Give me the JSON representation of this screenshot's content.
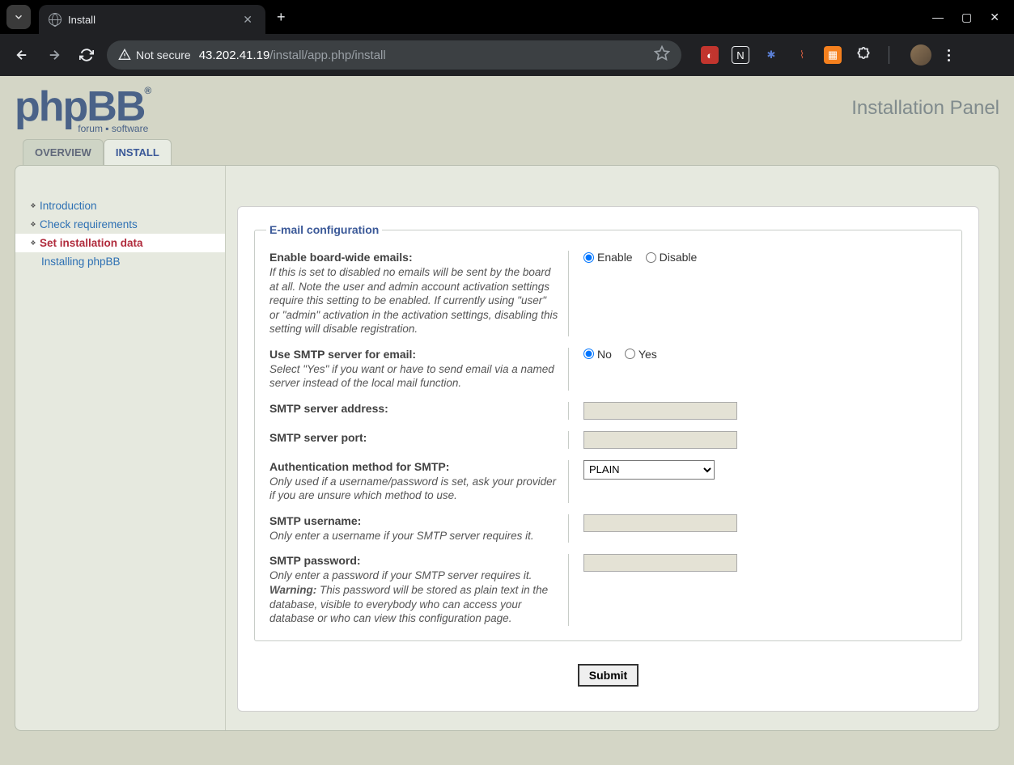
{
  "browser": {
    "tab_title": "Install",
    "not_secure_label": "Not secure",
    "url_host": "43.202.41.19",
    "url_path": "/install/app.php/install"
  },
  "header": {
    "logo_main": "phpBB",
    "logo_sub": "forum ▪ software",
    "panel_title": "Installation Panel"
  },
  "tabs": [
    {
      "label": "OVERVIEW",
      "active": false
    },
    {
      "label": "INSTALL",
      "active": true
    }
  ],
  "sidebar": {
    "items": [
      {
        "label": "Introduction",
        "active": false,
        "bullet": true
      },
      {
        "label": "Check requirements",
        "active": false,
        "bullet": true
      },
      {
        "label": "Set installation data",
        "active": true,
        "bullet": true
      },
      {
        "label": "Installing phpBB",
        "active": false,
        "bullet": false,
        "sub": true
      }
    ]
  },
  "form": {
    "legend": "E-mail configuration",
    "fields": {
      "enable_email": {
        "label": "Enable board-wide emails:",
        "desc": "If this is set to disabled no emails will be sent by the board at all. Note the user and admin account activation settings require this setting to be enabled. If currently using \"user\" or \"admin\" activation in the activation settings, disabling this setting will disable registration.",
        "opt1": "Enable",
        "opt2": "Disable",
        "selected": "Enable"
      },
      "use_smtp": {
        "label": "Use SMTP server for email:",
        "desc": "Select \"Yes\" if you want or have to send email via a named server instead of the local mail function.",
        "opt1": "No",
        "opt2": "Yes",
        "selected": "No"
      },
      "smtp_host": {
        "label": "SMTP server address:",
        "value": ""
      },
      "smtp_port": {
        "label": "SMTP server port:",
        "value": ""
      },
      "smtp_auth": {
        "label": "Authentication method for SMTP:",
        "desc": "Only used if a username/password is set, ask your provider if you are unsure which method to use.",
        "value": "PLAIN"
      },
      "smtp_user": {
        "label": "SMTP username:",
        "desc": "Only enter a username if your SMTP server requires it.",
        "value": ""
      },
      "smtp_pass": {
        "label": "SMTP password:",
        "desc_pre": "Only enter a password if your SMTP server requires it. ",
        "warn": "Warning:",
        "desc_post": " This password will be stored as plain text in the database, visible to everybody who can access your database or who can view this configuration page.",
        "value": ""
      }
    },
    "submit_label": "Submit"
  }
}
